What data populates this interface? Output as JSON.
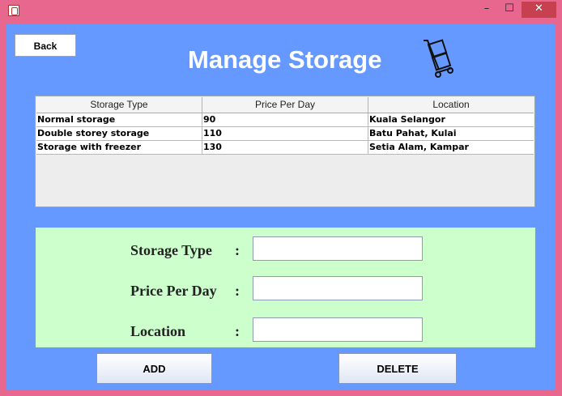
{
  "window": {
    "minimize_glyph": "–",
    "maximize_glyph": "☐",
    "close_glyph": "✕"
  },
  "header": {
    "back_label": "Back",
    "title": "Manage Storage",
    "title_icon": "cart-icon"
  },
  "table": {
    "columns": [
      "Storage Type",
      "Price Per Day",
      "Location"
    ],
    "rows": [
      [
        "Normal storage",
        "90",
        "Kuala Selangor"
      ],
      [
        "Double storey storage",
        "110",
        "Batu Pahat, Kulai"
      ],
      [
        "Storage with freezer",
        "130",
        "Setia Alam, Kampar"
      ]
    ]
  },
  "form": {
    "storage_type_label": "Storage Type",
    "price_label": "Price Per Day",
    "location_label": "Location",
    "colon": ":",
    "storage_type_value": "",
    "price_value": "",
    "location_value": ""
  },
  "actions": {
    "add_label": "ADD",
    "delete_label": "DELETE"
  },
  "colors": {
    "window_frame": "#e8678f",
    "client_bg": "#6699ff",
    "form_panel_bg": "#ccffcc"
  }
}
